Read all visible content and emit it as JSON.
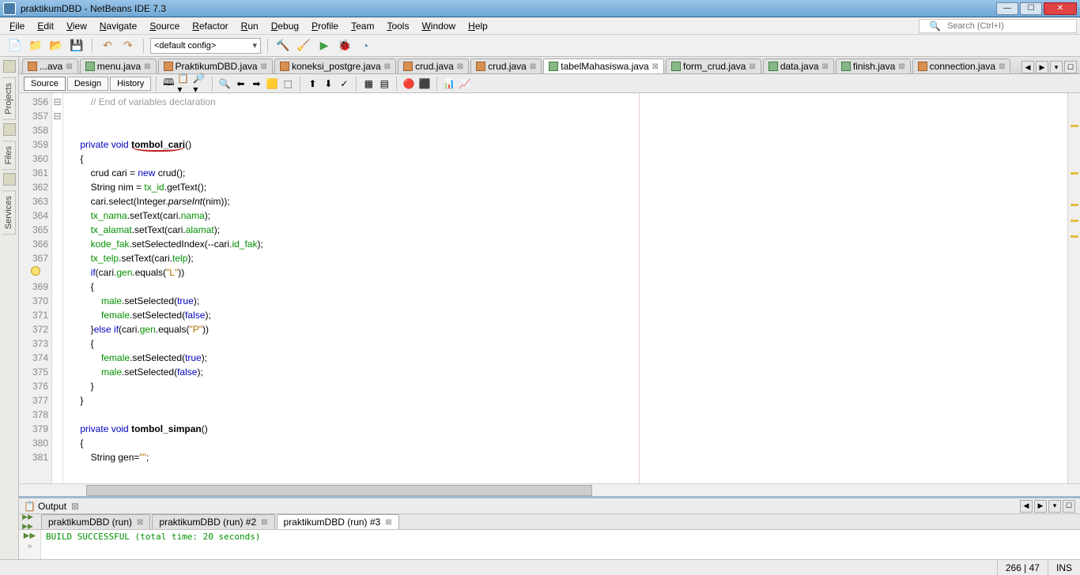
{
  "window": {
    "title": "praktikumDBD - NetBeans IDE 7.3"
  },
  "menu": [
    "File",
    "Edit",
    "View",
    "Navigate",
    "Source",
    "Refactor",
    "Run",
    "Debug",
    "Profile",
    "Team",
    "Tools",
    "Window",
    "Help"
  ],
  "search_placeholder": "Search (Ctrl+I)",
  "config": "<default config>",
  "side_tabs": [
    "Projects",
    "Files",
    "Services"
  ],
  "file_tabs": [
    {
      "label": "...ava",
      "icon": "java",
      "active": false
    },
    {
      "label": "menu.java",
      "icon": "form",
      "active": false
    },
    {
      "label": "PraktikumDBD.java",
      "icon": "java",
      "active": false
    },
    {
      "label": "koneksi_postgre.java",
      "icon": "java",
      "active": false
    },
    {
      "label": "crud.java",
      "icon": "java",
      "active": false
    },
    {
      "label": "crud.java",
      "icon": "java",
      "active": false
    },
    {
      "label": "tabelMahasiswa.java",
      "icon": "form",
      "active": true
    },
    {
      "label": "form_crud.java",
      "icon": "form",
      "active": false
    },
    {
      "label": "data.java",
      "icon": "form",
      "active": false
    },
    {
      "label": "finish.java",
      "icon": "form",
      "active": false
    },
    {
      "label": "connection.java",
      "icon": "java",
      "active": false
    }
  ],
  "view_buttons": [
    "Source",
    "Design",
    "History"
  ],
  "active_view": "Source",
  "line_start": 356,
  "code_lines": [
    {
      "t": "        // End of variables declaration",
      "cls": "cmt"
    },
    {
      "t": ""
    },
    {
      "t": ""
    },
    {
      "t": "    private void tombol_cari()",
      "tokens": [
        [
          "    ",
          ""
        ],
        [
          "private",
          "kw"
        ],
        [
          " ",
          ""
        ],
        [
          "void",
          "kw"
        ],
        [
          " ",
          ""
        ],
        [
          "tombol_cari",
          "meth underline-red"
        ],
        [
          "()",
          ""
        ]
      ]
    },
    {
      "t": "    {",
      "fold": "⊟"
    },
    {
      "t": "        crud cari = new crud();",
      "tokens": [
        [
          "        ",
          ""
        ],
        [
          "crud",
          ""
        ],
        [
          " cari = ",
          ""
        ],
        [
          "new",
          "kw"
        ],
        [
          " crud();",
          ""
        ]
      ]
    },
    {
      "t": "        String nim = tx_id.getText();",
      "tokens": [
        [
          "        String nim = ",
          ""
        ],
        [
          "tx_id",
          "fld"
        ],
        [
          ".getText();",
          ""
        ]
      ]
    },
    {
      "t": "        cari.select(Integer.parseInt(nim));",
      "tokens": [
        [
          "        cari.select(Integer.",
          ""
        ],
        [
          "parseInt",
          "ital"
        ],
        [
          "(nim));",
          ""
        ]
      ]
    },
    {
      "t": "        tx_nama.setText(cari.nama);",
      "tokens": [
        [
          "        ",
          ""
        ],
        [
          "tx_nama",
          "fld"
        ],
        [
          ".setText(cari.",
          ""
        ],
        [
          "nama",
          "fld"
        ],
        [
          ");",
          ""
        ]
      ]
    },
    {
      "t": "        tx_alamat.setText(cari.alamat);",
      "tokens": [
        [
          "        ",
          ""
        ],
        [
          "tx_alamat",
          "fld"
        ],
        [
          ".setText(cari.",
          ""
        ],
        [
          "alamat",
          "fld"
        ],
        [
          ");",
          ""
        ]
      ]
    },
    {
      "t": "        kode_fak.setSelectedIndex(--cari.id_fak);",
      "tokens": [
        [
          "        ",
          ""
        ],
        [
          "kode_fak",
          "fld"
        ],
        [
          ".setSelectedIndex(--cari.",
          ""
        ],
        [
          "id_fak",
          "fld"
        ],
        [
          ");",
          ""
        ]
      ]
    },
    {
      "t": "        tx_telp.setText(cari.telp);",
      "tokens": [
        [
          "        ",
          ""
        ],
        [
          "tx_telp",
          "fld"
        ],
        [
          ".setText(cari.",
          ""
        ],
        [
          "telp",
          "fld"
        ],
        [
          ");",
          ""
        ]
      ]
    },
    {
      "t": "        if(cari.gen.equals(\"L\"))",
      "tokens": [
        [
          "        ",
          ""
        ],
        [
          "if",
          "kw"
        ],
        [
          "(cari.",
          ""
        ],
        [
          "gen",
          "fld"
        ],
        [
          ".equals(",
          ""
        ],
        [
          "\"L\"",
          "str"
        ],
        [
          "))",
          ""
        ]
      ],
      "warn": true
    },
    {
      "t": "        {"
    },
    {
      "t": "            male.setSelected(true);",
      "tokens": [
        [
          "            ",
          ""
        ],
        [
          "male",
          "fld"
        ],
        [
          ".setSelected(",
          ""
        ],
        [
          "true",
          "bool"
        ],
        [
          ");",
          ""
        ]
      ]
    },
    {
      "t": "            female.setSelected(false);",
      "tokens": [
        [
          "            ",
          ""
        ],
        [
          "female",
          "fld"
        ],
        [
          ".setSelected(",
          ""
        ],
        [
          "false",
          "bool"
        ],
        [
          ");",
          ""
        ]
      ]
    },
    {
      "t": "        }else if(cari.gen.equals(\"P\"))",
      "tokens": [
        [
          "        }",
          ""
        ],
        [
          "else",
          "kw"
        ],
        [
          " ",
          ""
        ],
        [
          "if",
          "kw"
        ],
        [
          "(cari.",
          ""
        ],
        [
          "gen",
          "fld"
        ],
        [
          ".equals(",
          ""
        ],
        [
          "\"P\"",
          "str"
        ],
        [
          "))",
          ""
        ]
      ]
    },
    {
      "t": "        {"
    },
    {
      "t": "            female.setSelected(true);",
      "tokens": [
        [
          "            ",
          ""
        ],
        [
          "female",
          "fld"
        ],
        [
          ".setSelected(",
          ""
        ],
        [
          "true",
          "bool"
        ],
        [
          ");",
          ""
        ]
      ]
    },
    {
      "t": "            male.setSelected(false);",
      "tokens": [
        [
          "            ",
          ""
        ],
        [
          "male",
          "fld"
        ],
        [
          ".setSelected(",
          ""
        ],
        [
          "false",
          "bool"
        ],
        [
          ");",
          ""
        ]
      ]
    },
    {
      "t": "        }"
    },
    {
      "t": "    }"
    },
    {
      "t": ""
    },
    {
      "t": "    private void tombol_simpan()",
      "tokens": [
        [
          "    ",
          ""
        ],
        [
          "private",
          "kw"
        ],
        [
          " ",
          ""
        ],
        [
          "void",
          "kw"
        ],
        [
          " ",
          ""
        ],
        [
          "tombol_simpan",
          "meth"
        ],
        [
          "()",
          ""
        ]
      ]
    },
    {
      "t": "    {",
      "fold": "⊟"
    },
    {
      "t": "        String gen=\"\";",
      "tokens": [
        [
          "        String gen=",
          ""
        ],
        [
          "\"\"",
          "str"
        ],
        [
          ";",
          ""
        ]
      ]
    }
  ],
  "output": {
    "title": "Output",
    "tabs": [
      {
        "label": "praktikumDBD (run)",
        "active": false
      },
      {
        "label": "praktikumDBD (run) #2",
        "active": false
      },
      {
        "label": "praktikumDBD (run) #3",
        "active": true
      }
    ],
    "text": "BUILD SUCCESSFUL (total time: 20 seconds)"
  },
  "status": {
    "pos": "266 | 47",
    "mode": "INS"
  }
}
